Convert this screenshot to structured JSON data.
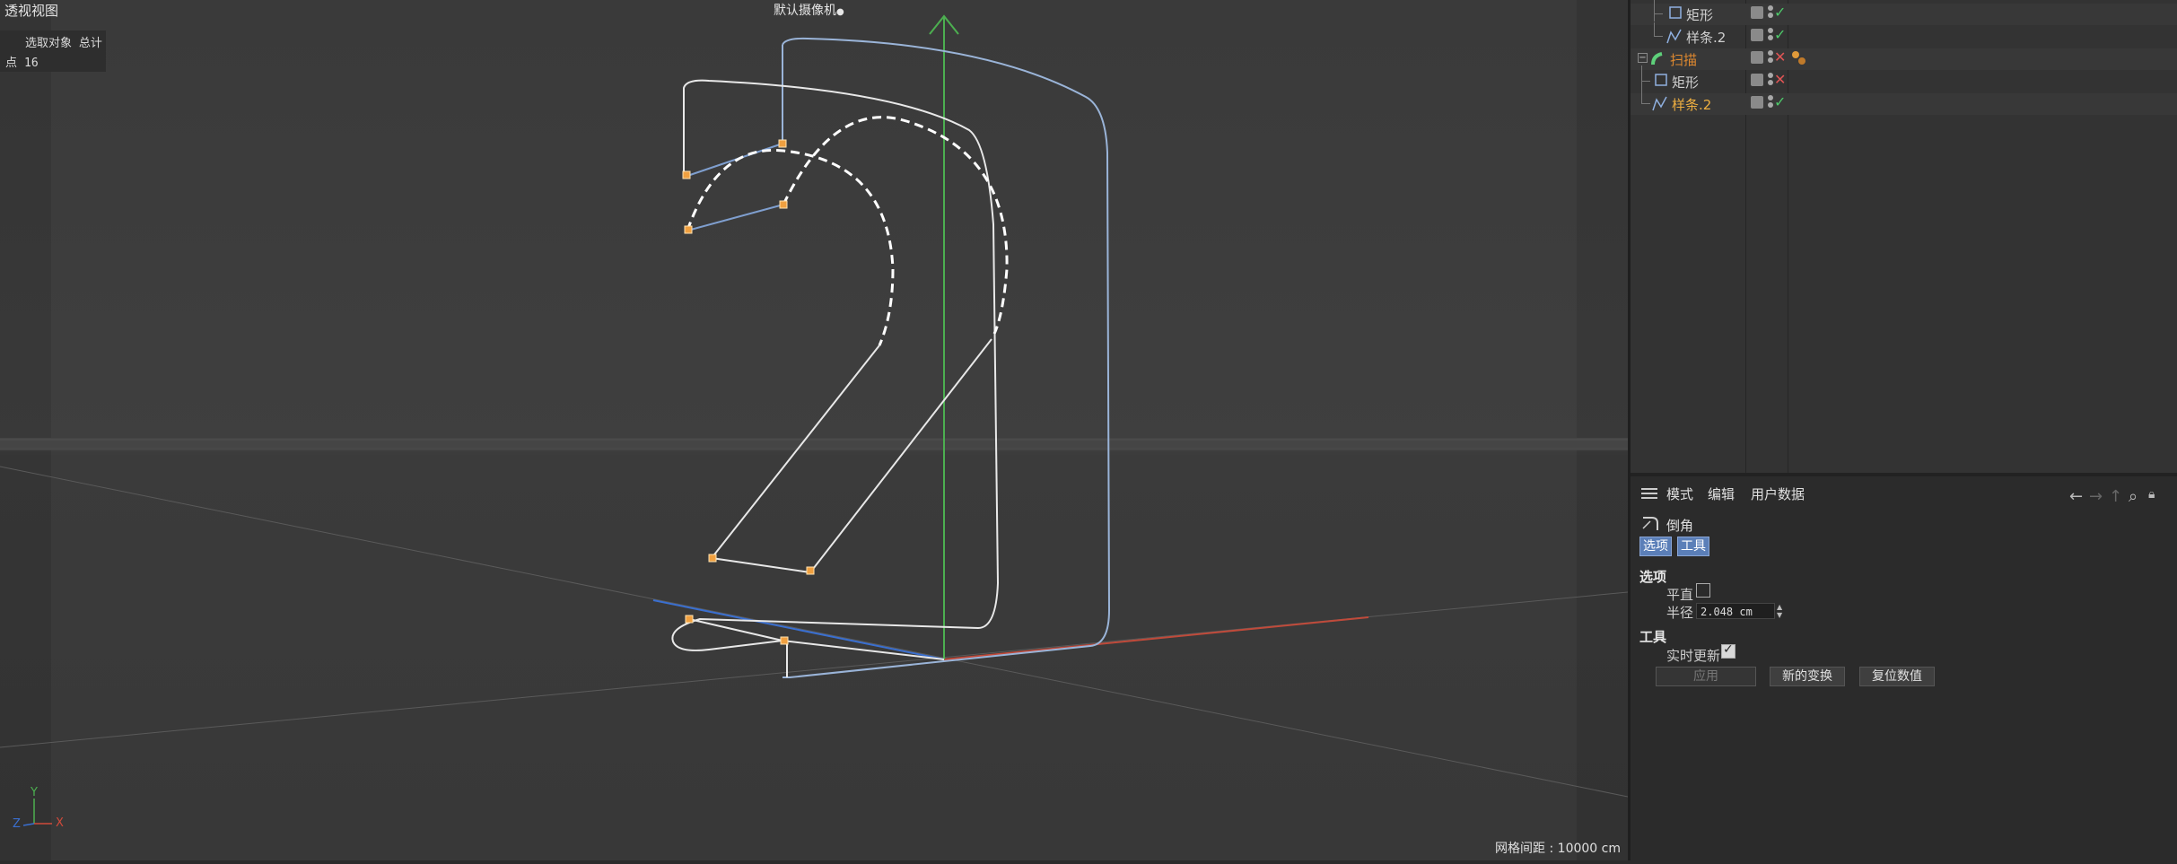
{
  "viewport": {
    "title": "透视视图",
    "camera": "默认摄像机",
    "stats_header": "选取对象 总计",
    "stats_row_label": "点",
    "stats_row_value": "16",
    "grid_spacing": "网格间距 : 10000 cm",
    "axis_labels": {
      "y": "Y",
      "x": "X",
      "z": "Z"
    }
  },
  "object_manager": {
    "rows": [
      {
        "name": "矩形",
        "icon": "rectangle-icon",
        "state": "check"
      },
      {
        "name": "样条.2",
        "icon": "spline-icon",
        "state": "check"
      },
      {
        "name": "扫描",
        "icon": "sweep-icon",
        "state": "cross",
        "color": "#e0892f"
      },
      {
        "name": "矩形",
        "icon": "rectangle-icon",
        "state": "cross"
      },
      {
        "name": "样条.2",
        "icon": "spline-icon",
        "state": "check",
        "color": "#f0b040"
      }
    ]
  },
  "attributes": {
    "menu": [
      "模式",
      "编辑",
      "用户数据"
    ],
    "tool_name": "倒角",
    "tabs": [
      "选项",
      "工具"
    ],
    "section_options": "选项",
    "flat_label": "平直",
    "flat_checked": false,
    "radius_label": "半径",
    "radius_value": "2.048 cm",
    "section_tool": "工具",
    "realtime_label": "实时更新",
    "realtime_checked": true,
    "buttons": {
      "apply": "应用",
      "new_transform": "新的变换",
      "reset": "复位数值"
    }
  },
  "colors": {
    "spline_white": "#e8e8e8",
    "spline_blue": "#9ab4d8",
    "point_orange": "#f0a040",
    "axis_y": "#4caf50",
    "axis_x": "#d04a3a",
    "axis_z": "#3a6fd0",
    "accent_tab": "#5b7fb8"
  }
}
